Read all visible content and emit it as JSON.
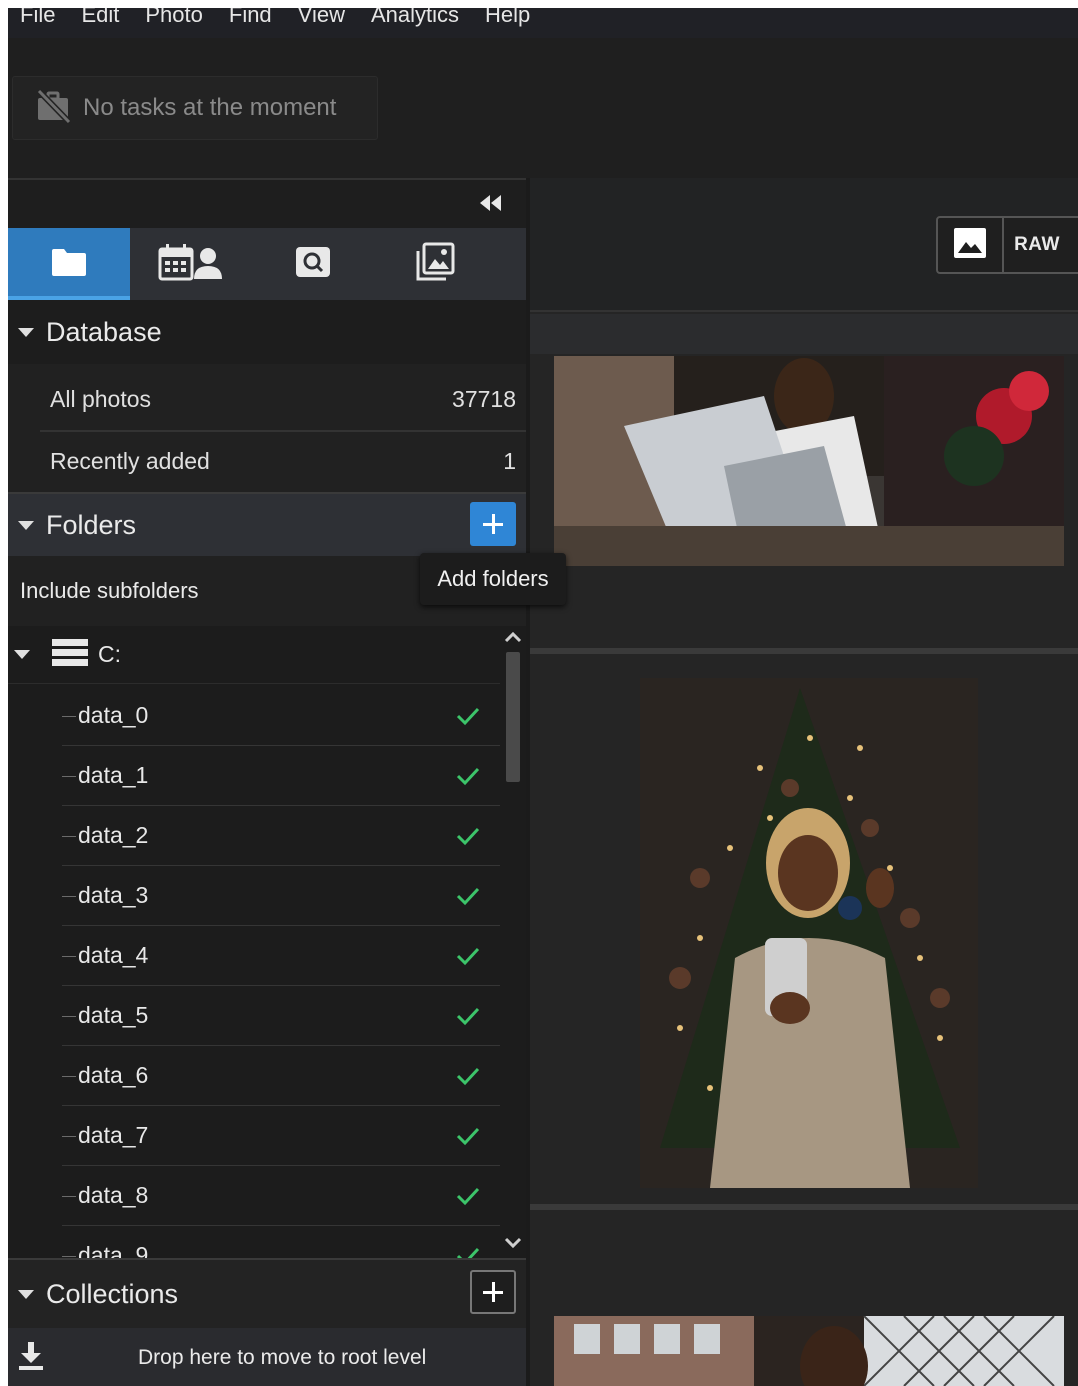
{
  "menu": [
    "File",
    "Edit",
    "Photo",
    "Find",
    "View",
    "Analytics",
    "Help"
  ],
  "tasks": {
    "text": "No tasks at the moment",
    "icon": "no-tasks-icon"
  },
  "tabs": [
    {
      "name": "folders-tab",
      "icon": "folder-icon",
      "active": true
    },
    {
      "name": "calendar-people-tab",
      "icon": "calendar-person-icon",
      "active": false
    },
    {
      "name": "search-tab",
      "icon": "search-icon",
      "active": false
    },
    {
      "name": "gallery-tab",
      "icon": "gallery-icon",
      "active": false
    }
  ],
  "database": {
    "title": "Database",
    "items": [
      {
        "label": "All photos",
        "count": "37718"
      },
      {
        "label": "Recently added",
        "count": "1"
      }
    ]
  },
  "folders": {
    "title": "Folders",
    "add_tooltip": "Add folders",
    "include_subfolders": "Include subfolders",
    "drive": "C:",
    "items": [
      "data_0",
      "data_1",
      "data_2",
      "data_3",
      "data_4",
      "data_5",
      "data_6",
      "data_7",
      "data_8",
      "data_9"
    ]
  },
  "collections": {
    "title": "Collections"
  },
  "drop_text": "Drop here to move to root level",
  "view_toggle": {
    "raw_label": "RAW"
  },
  "colors": {
    "accent": "#2f7bbd",
    "check": "#3cc46a",
    "panel": "#212121"
  }
}
